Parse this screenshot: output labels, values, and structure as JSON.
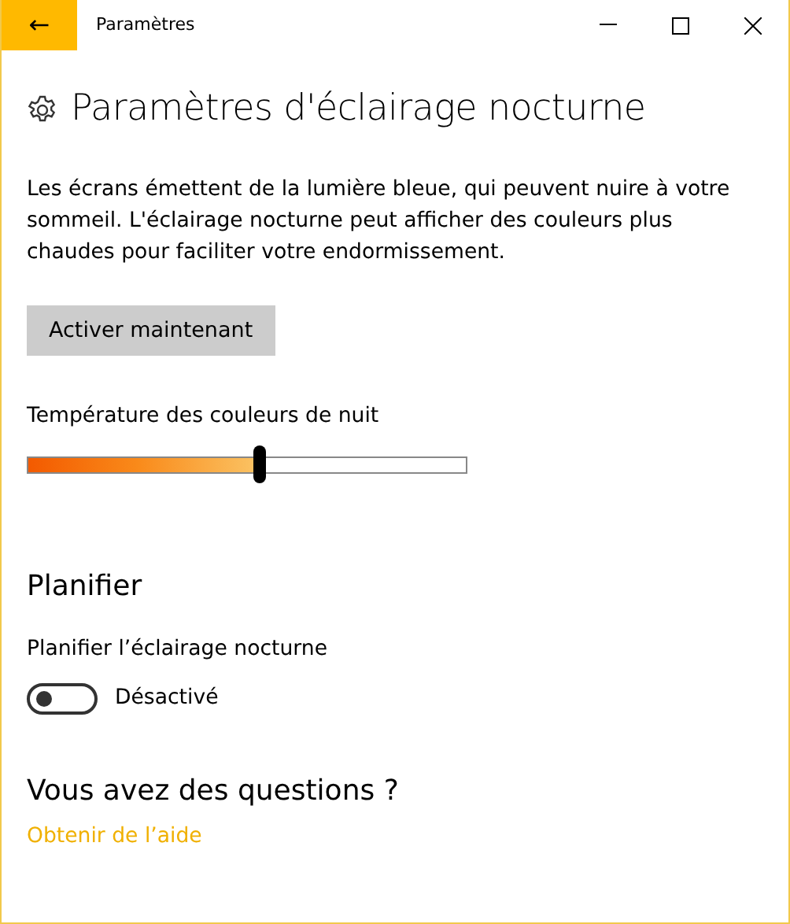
{
  "window": {
    "title": "Paramètres",
    "back_icon": "←"
  },
  "page": {
    "title": "Paramètres d'éclairage nocturne",
    "description": "Les écrans émettent de la lumière bleue, qui peuvent nuire à votre sommeil. L'éclairage nocturne peut afficher des couleurs plus chaudes pour faciliter votre endormissement.",
    "button": "Activer maintenant"
  },
  "slider": {
    "label": "Température des couleurs de nuit",
    "level": 0.53
  },
  "schedule": {
    "heading": "Planifier",
    "label": "Planifier l’éclairage nocturne",
    "on": false,
    "state_text": "Désactivé"
  },
  "help": {
    "heading": "Vous avez des questions ?",
    "link": "Obtenir de l’aide"
  }
}
